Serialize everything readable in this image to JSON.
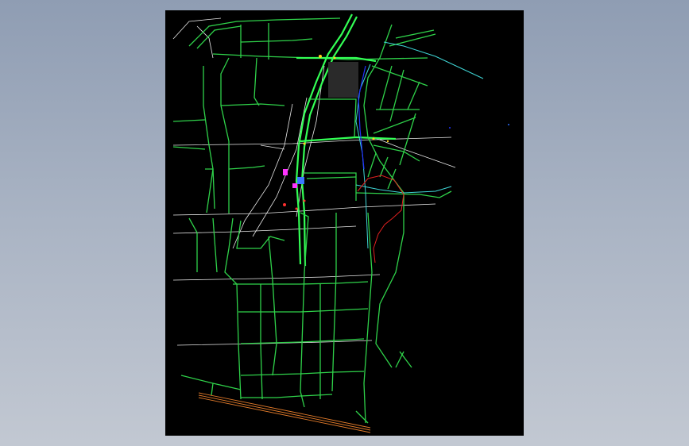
{
  "app": {
    "title": ""
  },
  "drawing": {
    "background": "#000000",
    "colors": {
      "road": "#2fd24a",
      "road_bright": "#33ff55",
      "centerline": "#e8e8e8",
      "water": "#3fd6d6",
      "boundary": "#e02020",
      "rail": "#e07a2a",
      "highlight": "#ff33ff",
      "marker": "#ffd21a",
      "river": "#2233ff"
    }
  }
}
